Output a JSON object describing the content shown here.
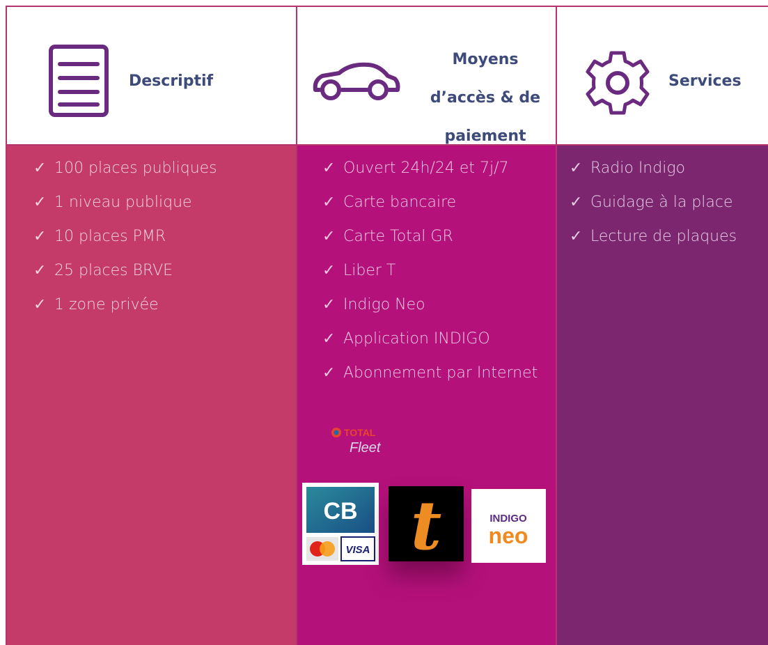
{
  "columns": [
    {
      "title": "Descriptif",
      "icon": "document-list-icon",
      "items": [
        "100 places publiques",
        "1 niveau publique",
        "10 places PMR",
        "25 places BRVE",
        "1 zone privée"
      ]
    },
    {
      "title_lines": [
        "Moyens",
        "d’accès & de",
        "paiement"
      ],
      "icon": "car-icon",
      "items": [
        "Ouvert 24h/24 et 7j/7",
        "Carte bancaire",
        "Carte Total GR",
        "Liber T",
        "Indigo Neo",
        "Application INDIGO",
        "Abonnement par Internet"
      ]
    },
    {
      "title": "Services",
      "icon": "gear-icon",
      "items": [
        "Radio Indigo",
        "Guidage à la place",
        "Lecture de plaques"
      ]
    }
  ],
  "check_glyph": "✓",
  "logos": {
    "total": {
      "brand": "TOTAL",
      "sub": "Fleet"
    },
    "cb": {
      "top": "CB",
      "bottom": "VISA"
    },
    "libert": {
      "letter": "t"
    },
    "indigo": {
      "line1": "INDIGO",
      "line2": "neo"
    }
  },
  "colors": {
    "border": "#b5336f",
    "title_text": "#3d4a7a",
    "icon_purple": "#6a2a80",
    "col1_bg": "#c43a68",
    "col2_bg": "#b5117b",
    "col3_bg": "#7d2670"
  }
}
